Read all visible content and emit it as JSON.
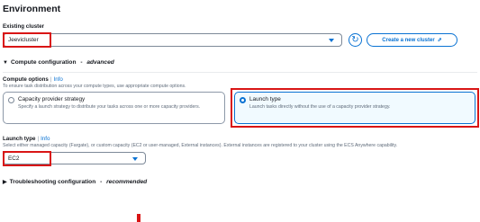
{
  "environment": {
    "title": "Environment",
    "existing_cluster": {
      "label": "Existing cluster",
      "value": "Jeevicluster"
    },
    "refresh_icon": "refresh-icon",
    "create_cluster_label": "Create a new cluster",
    "external_link_icon": "external-link-icon"
  },
  "compute_configuration": {
    "title": "Compute configuration",
    "dash": " - ",
    "mode": "advanced",
    "compute_options": {
      "label": "Compute options",
      "info": "Info",
      "description": "To ensure task distribution across your compute types, use appropriate compute options.",
      "options": [
        {
          "title": "Capacity provider strategy",
          "description": "Specify a launch strategy to distribute your tasks across one or more capacity providers.",
          "selected": false
        },
        {
          "title": "Launch type",
          "description": "Launch tasks directly without the use of a capacity provider strategy.",
          "selected": true
        }
      ]
    },
    "launch_type": {
      "label": "Launch type",
      "info": "Info",
      "description": "Select either managed capacity (Fargate), or custom capacity (EC2 or user-managed, External instances). External instances are registered to your cluster using the ECS Anywhere capability.",
      "value": "EC2"
    }
  },
  "troubleshooting": {
    "title": "Troubleshooting configuration",
    "dash": " - ",
    "mode": "recommended"
  },
  "colors": {
    "accent": "#0972d3",
    "highlight": "#d91515",
    "selected_tile_bg": "#f1faff"
  }
}
